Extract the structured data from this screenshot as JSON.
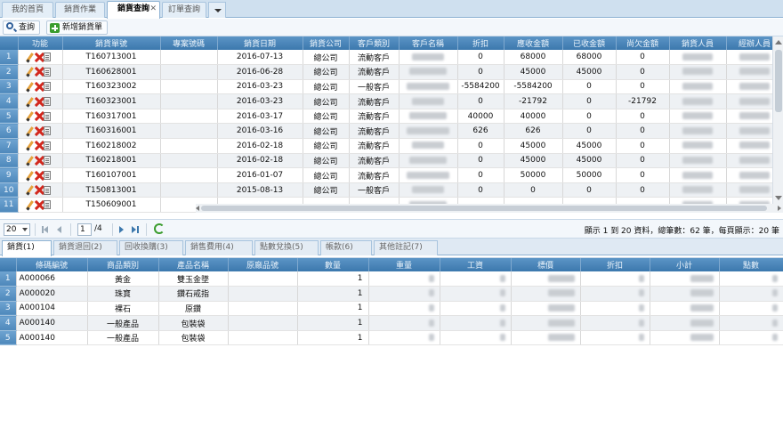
{
  "tabs": [
    {
      "label": "我的首頁",
      "active": false
    },
    {
      "label": "銷貨作業",
      "active": false
    },
    {
      "label": "銷貨查詢",
      "active": true
    },
    {
      "label": "訂單查詢",
      "active": false
    }
  ],
  "toolbar": {
    "search_label": "查詢",
    "new_label": "新增銷貨單"
  },
  "main_grid": {
    "headers": [
      "功能",
      "銷貨單號",
      "專案號碼",
      "銷貨日期",
      "銷貨公司",
      "客戶類別",
      "客戶名稱",
      "折扣",
      "應收金額",
      "已收金額",
      "尚欠金額",
      "銷貨人員",
      "經辦人員"
    ],
    "rows": [
      {
        "n": "1",
        "no": "T160713001",
        "date": "2016-07-13",
        "co": "總公司",
        "type": "流動客戶",
        "disc": "0",
        "due": "68000",
        "recv": "68000",
        "owe": "0"
      },
      {
        "n": "2",
        "no": "T160628001",
        "date": "2016-06-28",
        "co": "總公司",
        "type": "流動客戶",
        "disc": "0",
        "due": "45000",
        "recv": "45000",
        "owe": "0"
      },
      {
        "n": "3",
        "no": "T160323002",
        "date": "2016-03-23",
        "co": "總公司",
        "type": "一般客戶",
        "disc": "-5584200",
        "due": "-5584200",
        "recv": "0",
        "owe": "0"
      },
      {
        "n": "4",
        "no": "T160323001",
        "date": "2016-03-23",
        "co": "總公司",
        "type": "流動客戶",
        "disc": "0",
        "due": "-21792",
        "recv": "0",
        "owe": "-21792"
      },
      {
        "n": "5",
        "no": "T160317001",
        "date": "2016-03-17",
        "co": "總公司",
        "type": "流動客戶",
        "disc": "40000",
        "due": "40000",
        "recv": "0",
        "owe": "0"
      },
      {
        "n": "6",
        "no": "T160316001",
        "date": "2016-03-16",
        "co": "總公司",
        "type": "流動客戶",
        "disc": "626",
        "due": "626",
        "recv": "0",
        "owe": "0"
      },
      {
        "n": "7",
        "no": "T160218002",
        "date": "2016-02-18",
        "co": "總公司",
        "type": "流動客戶",
        "disc": "0",
        "due": "45000",
        "recv": "45000",
        "owe": "0"
      },
      {
        "n": "8",
        "no": "T160218001",
        "date": "2016-02-18",
        "co": "總公司",
        "type": "流動客戶",
        "disc": "0",
        "due": "45000",
        "recv": "45000",
        "owe": "0"
      },
      {
        "n": "9",
        "no": "T160107001",
        "date": "2016-01-07",
        "co": "總公司",
        "type": "流動客戶",
        "disc": "0",
        "due": "50000",
        "recv": "50000",
        "owe": "0"
      },
      {
        "n": "10",
        "no": "T150813001",
        "date": "2015-08-13",
        "co": "總公司",
        "type": "一般客戶",
        "disc": "0",
        "due": "0",
        "recv": "0",
        "owe": "0"
      },
      {
        "n": "11",
        "no": "T150609001",
        "date": "",
        "co": "",
        "type": "",
        "disc": "",
        "due": "",
        "recv": "",
        "owe": ""
      }
    ]
  },
  "pager": {
    "page_size": "20",
    "page": "1",
    "total_pages": "/4",
    "info": "顯示 1 到 20 資料，總筆數：62 筆，每頁顯示：20 筆"
  },
  "bottom_tabs": [
    {
      "label": "銷貨(1)",
      "active": true
    },
    {
      "label": "銷貨退回(2)",
      "active": false
    },
    {
      "label": "回收換購(3)",
      "active": false
    },
    {
      "label": "銷售費用(4)",
      "active": false
    },
    {
      "label": "點數兌換(5)",
      "active": false
    },
    {
      "label": "帳款(6)",
      "active": false
    },
    {
      "label": "其他註記(7)",
      "active": false
    }
  ],
  "detail_grid": {
    "headers": [
      "條碼編號",
      "商品類別",
      "產品名稱",
      "原廠品號",
      "數量",
      "重量",
      "工資",
      "標價",
      "折扣",
      "小計",
      "點數"
    ],
    "rows": [
      {
        "n": "1",
        "code": "A000066",
        "cat": "黃金",
        "name": "雙玉金墜",
        "orig": "",
        "qty": "1"
      },
      {
        "n": "2",
        "code": "A000020",
        "cat": "珠寶",
        "name": "鑽石戒指",
        "orig": "",
        "qty": "1"
      },
      {
        "n": "3",
        "code": "A000104",
        "cat": "裸石",
        "name": "原鑽",
        "orig": "",
        "qty": "1"
      },
      {
        "n": "4",
        "code": "A000140",
        "cat": "一般產品",
        "name": "包裝袋",
        "orig": "",
        "qty": "1"
      },
      {
        "n": "5",
        "code": "A000140",
        "cat": "一般產品",
        "name": "包裝袋",
        "orig": "",
        "qty": "1"
      }
    ]
  },
  "colors": {
    "header_blue": "#4a86ba",
    "row_alt": "#eef1f4",
    "accent_green": "#3a9c2d",
    "delete_red": "#d2281e"
  }
}
